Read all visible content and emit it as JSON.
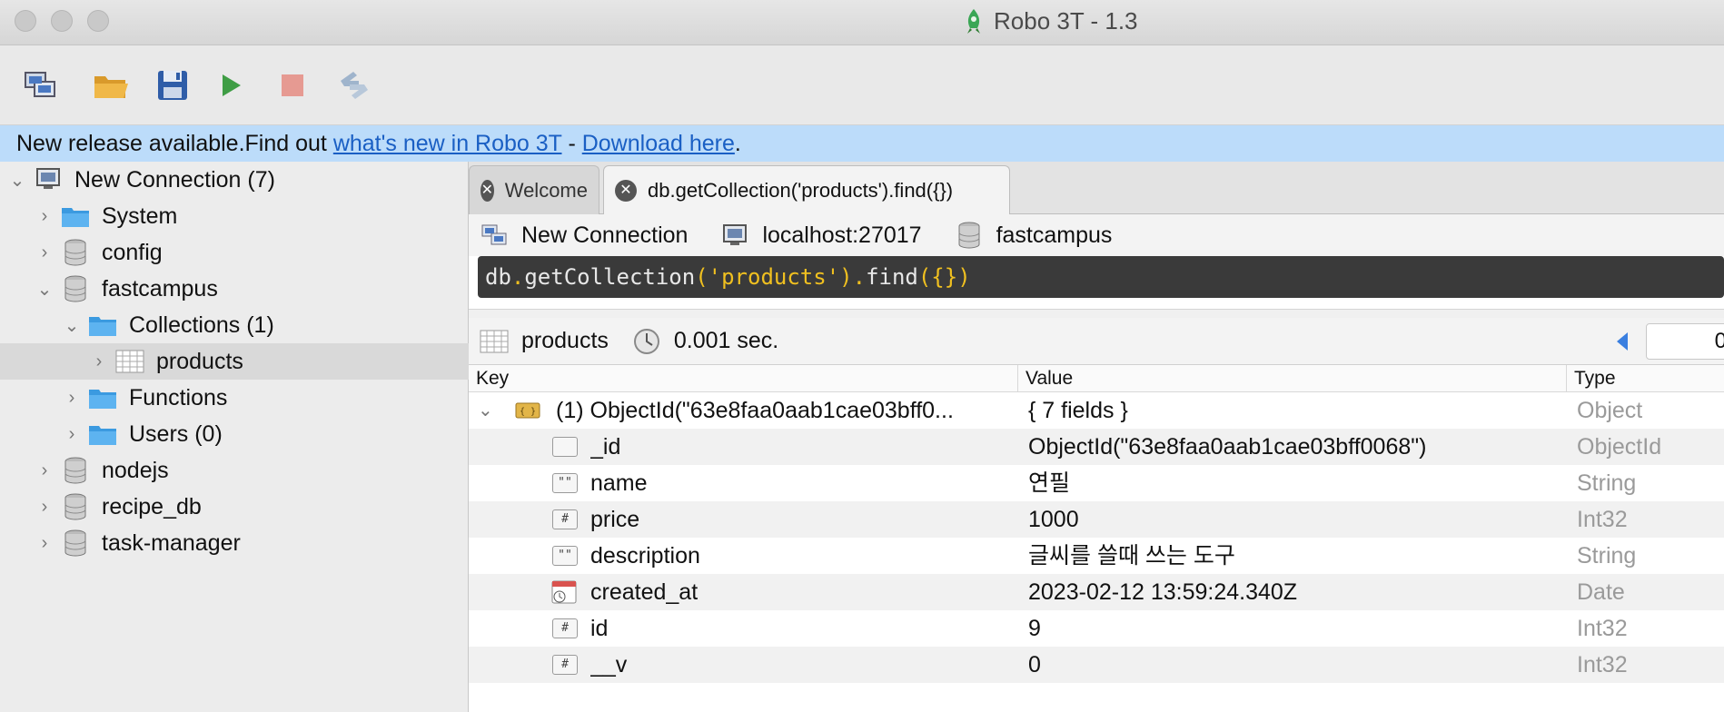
{
  "window": {
    "title": "Robo 3T - 1.3",
    "traffic_lights": [
      "close",
      "minimize",
      "zoom"
    ]
  },
  "toolbar": {
    "buttons": [
      {
        "name": "connect-icon"
      },
      {
        "name": "open-icon"
      },
      {
        "name": "save-icon"
      },
      {
        "name": "execute-icon"
      },
      {
        "name": "stop-icon"
      },
      {
        "name": "orientation-icon"
      }
    ]
  },
  "notice": {
    "prefix": "New release available.Find out ",
    "link1": "what's new in Robo 3T",
    "middle": " - ",
    "link2": "Download here",
    "suffix": "."
  },
  "sidebar": {
    "items": [
      {
        "label": "New Connection (7)",
        "icon": "computer-icon"
      },
      {
        "label": "System",
        "icon": "folder-icon"
      },
      {
        "label": "config",
        "icon": "database-icon"
      },
      {
        "label": "fastcampus",
        "icon": "database-icon"
      },
      {
        "label": "Collections (1)",
        "icon": "folder-icon"
      },
      {
        "label": "products",
        "icon": "table-icon"
      },
      {
        "label": "Functions",
        "icon": "folder-icon"
      },
      {
        "label": "Users (0)",
        "icon": "folder-icon"
      },
      {
        "label": "nodejs",
        "icon": "database-icon"
      },
      {
        "label": "recipe_db",
        "icon": "database-icon"
      },
      {
        "label": "task-manager",
        "icon": "database-icon"
      }
    ]
  },
  "tabs": [
    {
      "label": "Welcome",
      "active": false
    },
    {
      "label": "db.getCollection('products').find({})",
      "active": true
    }
  ],
  "connection": {
    "name": "New Connection",
    "host": "localhost:27017",
    "database": "fastcampus"
  },
  "query": {
    "t1": "db",
    "t2": ".",
    "t3": "getCollection",
    "t4": "(",
    "t5": "'products'",
    "t6": ")",
    "t7": ".",
    "t8": "find",
    "t9": "({})"
  },
  "result": {
    "collection": "products",
    "time": "0.001 sec.",
    "page": "0"
  },
  "table": {
    "headers": {
      "key": "Key",
      "value": "Value",
      "type": "Type"
    },
    "root": {
      "key": "(1) ObjectId(\"63e8faa0aab1cae03bff0...",
      "value": "{ 7 fields }",
      "type": "Object"
    },
    "fields": [
      {
        "key": "_id",
        "value": "ObjectId(\"63e8faa0aab1cae03bff0068\")",
        "type": "ObjectId",
        "icon": ""
      },
      {
        "key": "name",
        "value": "연필",
        "type": "String",
        "icon": "\"\""
      },
      {
        "key": "price",
        "value": "1000",
        "type": "Int32",
        "icon": "#"
      },
      {
        "key": "description",
        "value": "글씨를 쓸때 쓰는 도구",
        "type": "String",
        "icon": "\"\""
      },
      {
        "key": "created_at",
        "value": "2023-02-12 13:59:24.340Z",
        "type": "Date",
        "icon": "date"
      },
      {
        "key": "id",
        "value": "9",
        "type": "Int32",
        "icon": "#"
      },
      {
        "key": "__v",
        "value": "0",
        "type": "Int32",
        "icon": "#"
      }
    ]
  }
}
